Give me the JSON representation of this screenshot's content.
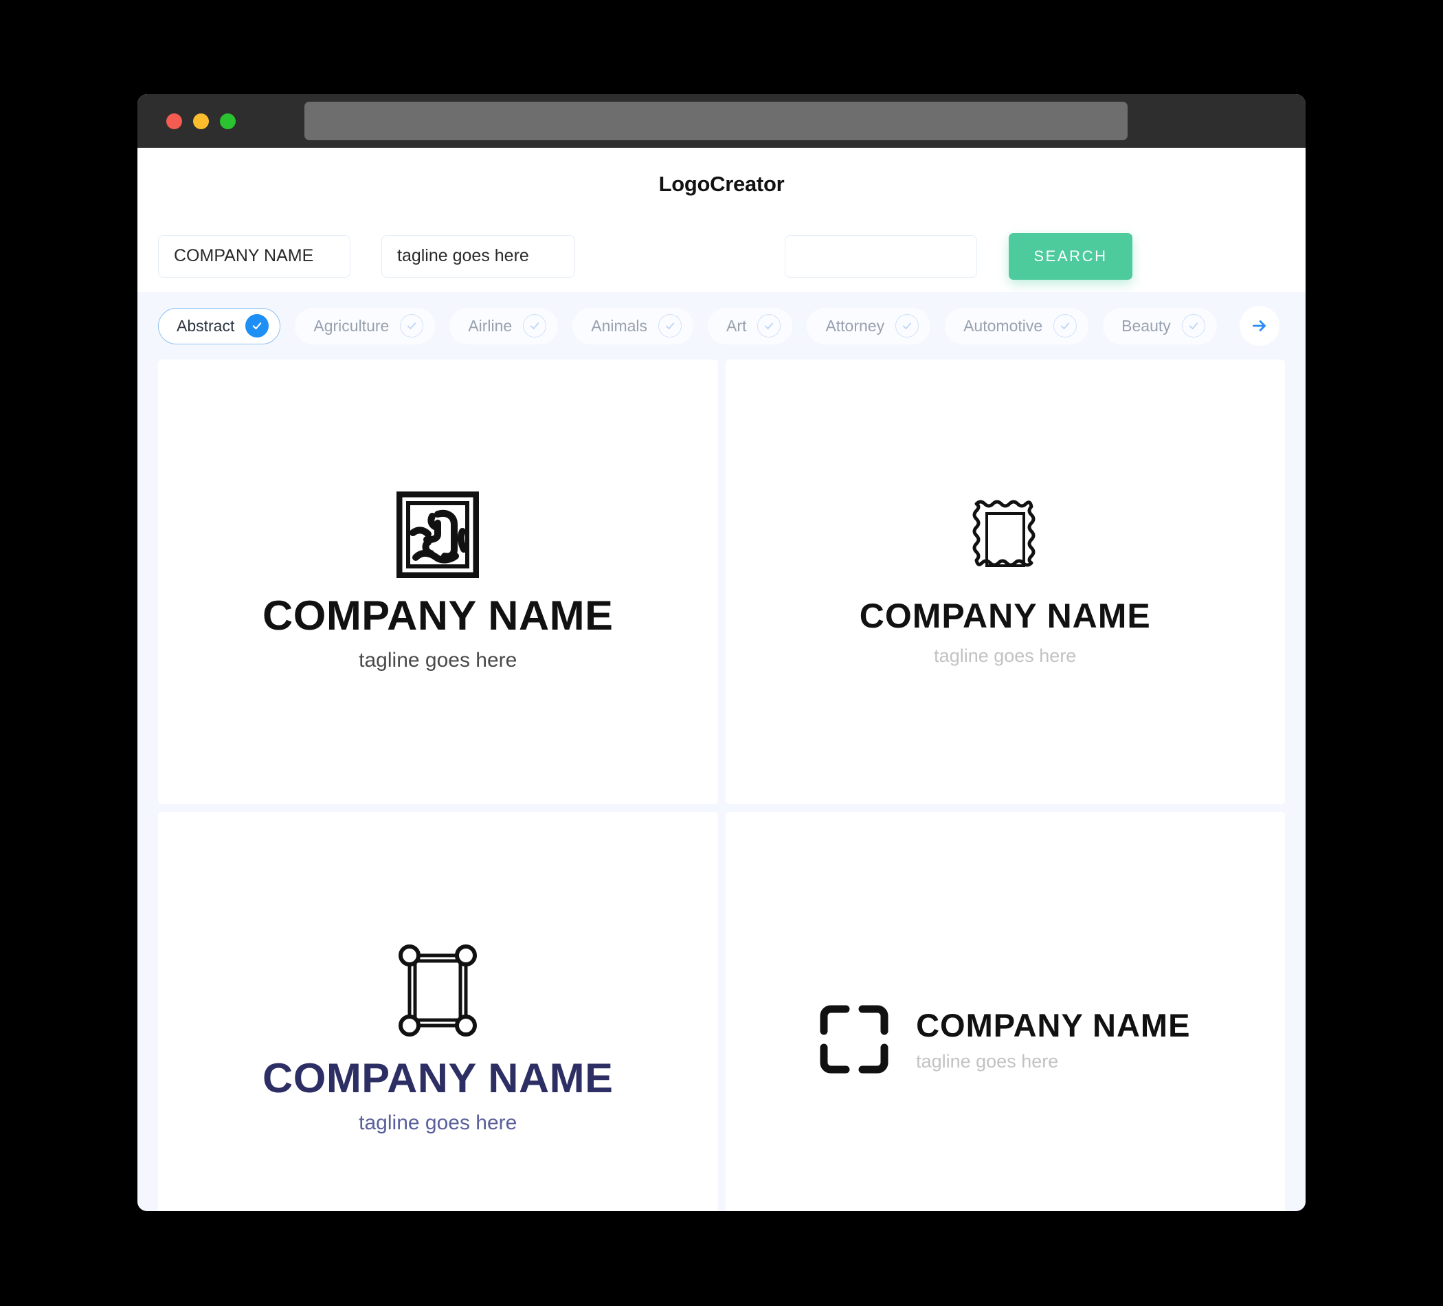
{
  "window": {
    "traffic_lights": [
      {
        "name": "close",
        "color": "#f45b51"
      },
      {
        "name": "minimize",
        "color": "#fbbd2e"
      },
      {
        "name": "maximize",
        "color": "#2ac430"
      }
    ],
    "address_bar_value": ""
  },
  "header": {
    "app_title": "LogoCreator"
  },
  "toolbar": {
    "company_value": "COMPANY NAME",
    "company_placeholder": "COMPANY NAME",
    "tagline_value": "tagline goes here",
    "tagline_placeholder": "tagline goes here",
    "extra_value": "",
    "extra_placeholder": "",
    "search_label": "SEARCH",
    "search_color": "#4ecb9c"
  },
  "categories": {
    "selected": "Abstract",
    "accent_color": "#1e8ff5",
    "next_arrow_icon": "arrow-right-icon",
    "items": [
      {
        "label": "Abstract",
        "selected": true
      },
      {
        "label": "Agriculture",
        "selected": false
      },
      {
        "label": "Airline",
        "selected": false
      },
      {
        "label": "Animals",
        "selected": false
      },
      {
        "label": "Art",
        "selected": false
      },
      {
        "label": "Attorney",
        "selected": false
      },
      {
        "label": "Automotive",
        "selected": false
      },
      {
        "label": "Beauty",
        "selected": false
      }
    ]
  },
  "results": [
    {
      "mark_icon": "framed-abstract-art-icon",
      "company_name": "COMPANY NAME",
      "tagline": "tagline goes here",
      "layout": "stacked",
      "text_color": "#111111",
      "tagline_color": "#4a4a4a"
    },
    {
      "mark_icon": "wavy-picture-frame-icon",
      "company_name": "COMPANY NAME",
      "tagline": "tagline goes here",
      "layout": "stacked",
      "text_color": "#111111",
      "tagline_color": "#c2c2c2"
    },
    {
      "mark_icon": "node-square-frame-icon",
      "company_name": "COMPANY NAME",
      "tagline": "tagline goes here",
      "layout": "stacked",
      "text_color": "#2d2e63",
      "tagline_color": "#5a5f9b"
    },
    {
      "mark_icon": "focus-brackets-icon",
      "company_name": "COMPANY NAME",
      "tagline": "tagline goes here",
      "layout": "horizontal",
      "text_color": "#111111",
      "tagline_color": "#c2c2c2"
    }
  ]
}
